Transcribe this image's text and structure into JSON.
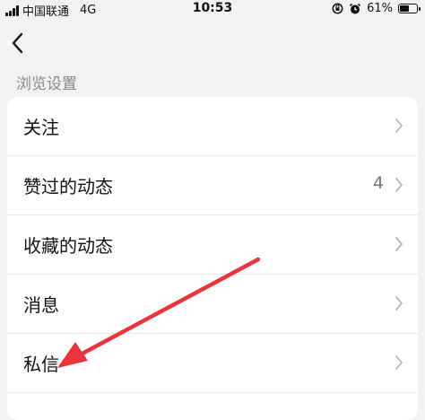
{
  "status_bar": {
    "carrier": "中国联通",
    "network": "4G",
    "time": "10:53",
    "battery_percent": "61%",
    "battery_level": 0.61
  },
  "nav": {
    "back_icon": "chevron-left-icon"
  },
  "section": {
    "title": "浏览设置"
  },
  "items": [
    {
      "label": "关注",
      "badge": ""
    },
    {
      "label": "赞过的动态",
      "badge": "4"
    },
    {
      "label": "收藏的动态",
      "badge": ""
    },
    {
      "label": "消息",
      "badge": ""
    },
    {
      "label": "私信",
      "badge": ""
    }
  ],
  "colors": {
    "background": "#f2f2f2",
    "card": "#ffffff",
    "annotation_arrow": "#e8343a"
  }
}
